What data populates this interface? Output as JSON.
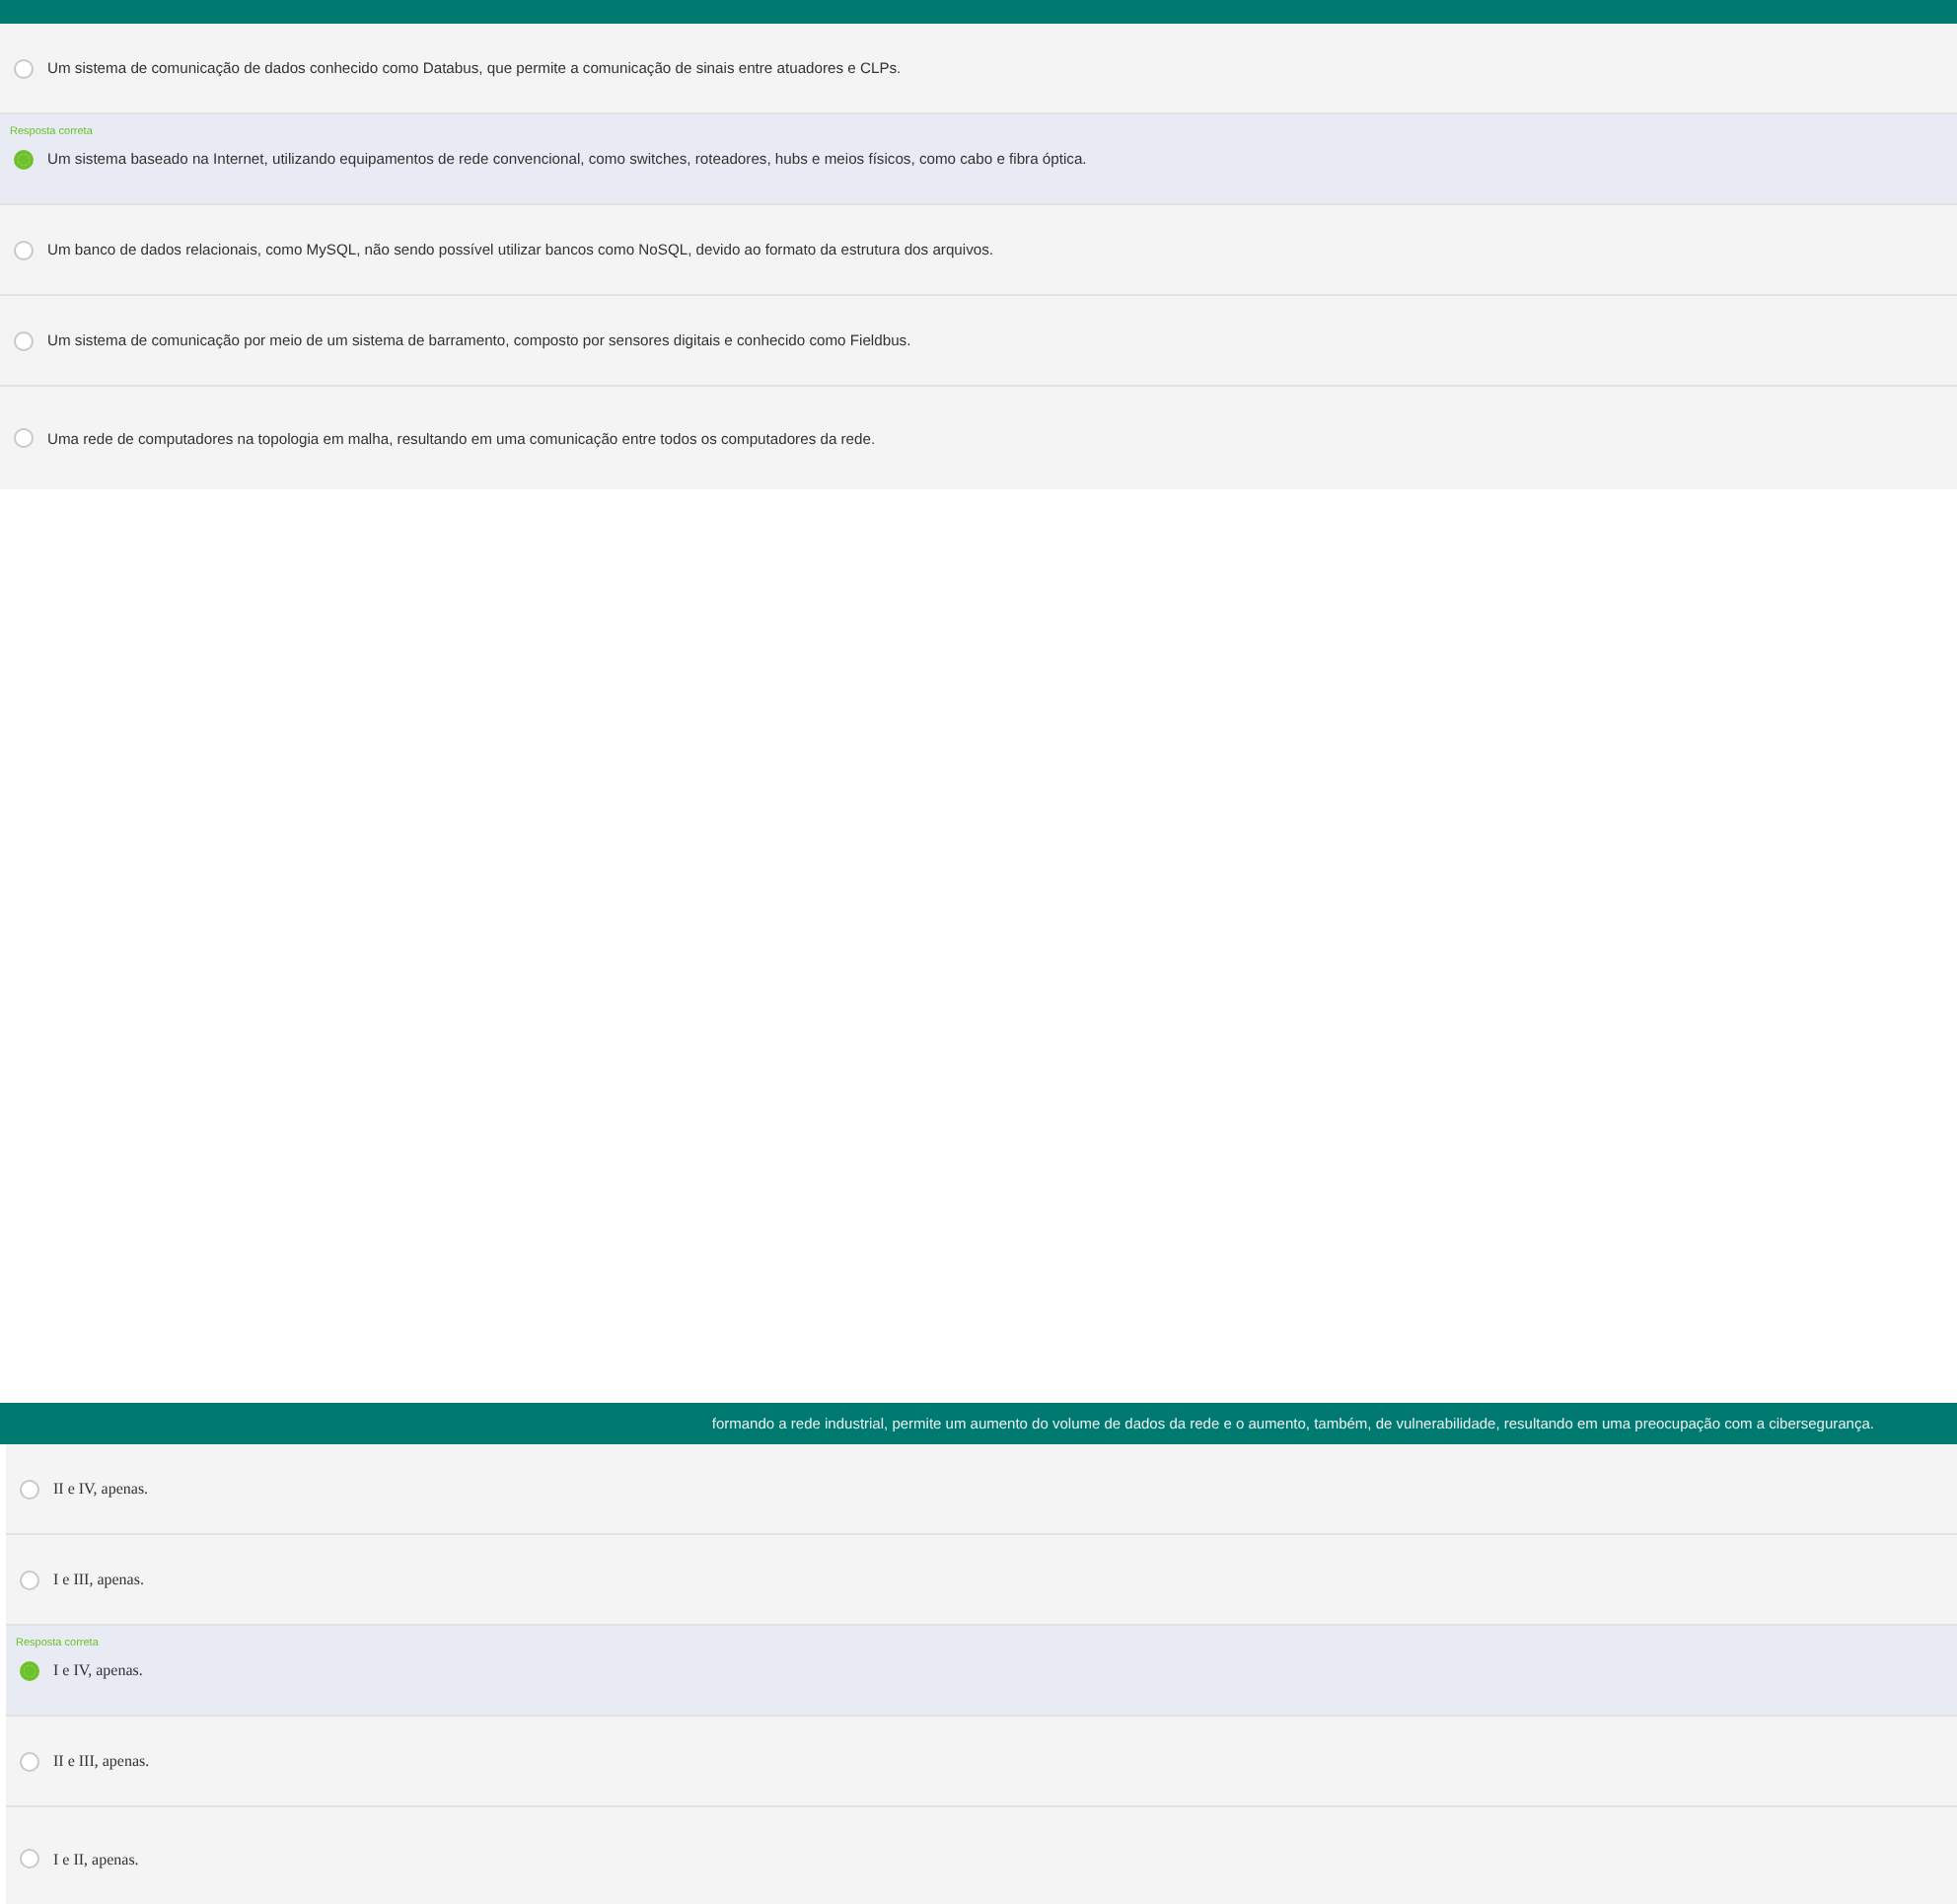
{
  "questions": [
    {
      "kind": "text",
      "options": [
        {
          "text": "Um sistema de comunicação de dados conhecido como Databus, que permite a comunicação de sinais entre atuadores e CLPs.",
          "selected": false
        },
        {
          "text": "Um sistema baseado na Internet, utilizando equipamentos de rede convencional, como switches, roteadores, hubs e meios físicos, como cabo e fibra óptica.",
          "selected": true,
          "note": "Resposta correta"
        },
        {
          "text": "Um banco de dados relacionais, como MySQL, não sendo possível utilizar bancos como NoSQL, devido ao formato da estrutura dos arquivos.",
          "selected": false
        },
        {
          "text": "Um sistema de comunicação por meio de um sistema de barramento, composto por sensores digitais e conhecido como Fieldbus.",
          "selected": false
        },
        {
          "text": "Uma rede de computadores na topologia em malha, resultando em uma comunicação entre todos os computadores da rede.",
          "selected": false
        }
      ]
    },
    {
      "kind": "numeral",
      "banner": "formando a rede industrial, permite um aumento do volume de dados da rede e o aumento, também, de vulnerabilidade, resultando em uma preocupação com a cibersegurança.",
      "options": [
        {
          "text": "II e IV, apenas.",
          "selected": false
        },
        {
          "text": "I e III, apenas.",
          "selected": false
        },
        {
          "text": "I e IV, apenas.",
          "selected": true,
          "note": "Resposta correta"
        },
        {
          "text": "II e III, apenas.",
          "selected": false
        },
        {
          "text": "I e II, apenas.",
          "selected": false
        }
      ]
    }
  ]
}
